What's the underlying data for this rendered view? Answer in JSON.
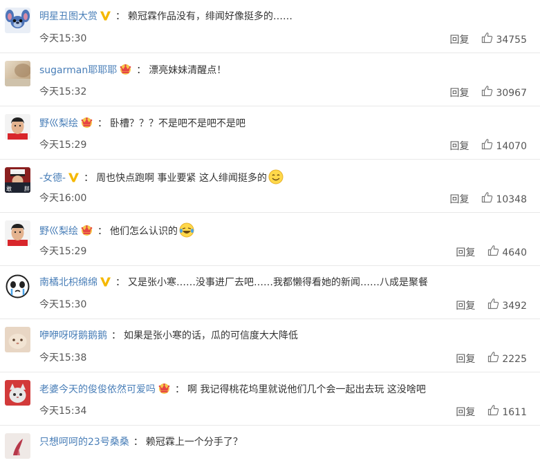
{
  "reply_label": "回复",
  "colors": {
    "username": "#4a7fb8",
    "text": "#333333",
    "meta": "#555555",
    "divider": "#e8e8e8",
    "vip_badge": "#f5b800",
    "crown_badge": "#e64545"
  },
  "comments": [
    {
      "user": "明星丑图大赏",
      "badge": "vip-v",
      "text": "赖冠霖作品没有，绯闻好像挺多的……",
      "emoji": "",
      "time": "今天15:30",
      "likes": "34755"
    },
    {
      "user": "sugarman耶耶耶",
      "badge": "crown",
      "text": "漂亮妹妹清醒点！",
      "emoji": "",
      "time": "今天15:32",
      "likes": "30967"
    },
    {
      "user": "野巛梨绘",
      "badge": "crown",
      "text": "卧槽？？？不是吧不是吧不是吧",
      "emoji": "",
      "time": "今天15:29",
      "likes": "14070"
    },
    {
      "user": "-女德-",
      "badge": "vip-v",
      "text": "周也快点跑啊 事业要紧 这人绯闻挺多的",
      "emoji": "smile",
      "time": "今天16:00",
      "likes": "10348"
    },
    {
      "user": "野巛梨绘",
      "badge": "crown",
      "text": "他们怎么认识的",
      "emoji": "laugh-cry",
      "time": "今天15:29",
      "likes": "4640"
    },
    {
      "user": "南橘北枳绵绵",
      "badge": "vip-v",
      "text": "又是张小寒……没事进厂去吧……我都懒得看她的新闻……八成是聚餐",
      "emoji": "",
      "time": "今天15:30",
      "likes": "3492"
    },
    {
      "user": "咿咿呀呀鹅鹅鹅",
      "badge": "",
      "text": "如果是张小寒的话，瓜的可信度大大降低",
      "emoji": "",
      "time": "今天15:38",
      "likes": "2225"
    },
    {
      "user": "老婆今天的俊俊依然可爱吗",
      "badge": "crown",
      "text": "啊 我记得桃花坞里就说他们几个会一起出去玩 这没啥吧",
      "emoji": "",
      "time": "今天15:34",
      "likes": "1611"
    },
    {
      "user": "只想呵呵的23号桑桑",
      "badge": "",
      "text": "赖冠霖上一个分手了？",
      "emoji": "",
      "time": "",
      "likes": ""
    }
  ]
}
